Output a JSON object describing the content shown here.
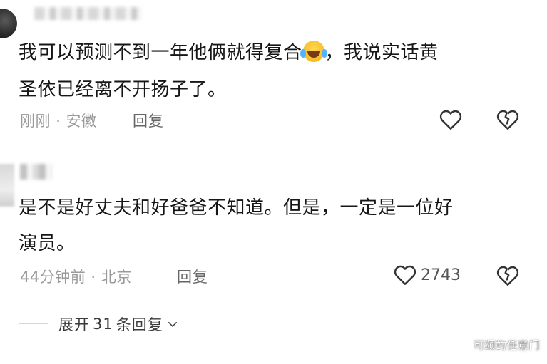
{
  "comments": [
    {
      "text_part1": "我可以预测不到一年他俩就得复合",
      "emoji": "rolling-on-floor-laughing",
      "text_part2": "，我说实话黄",
      "text_line2": "圣依已经离不开扬子了。",
      "time": "刚刚",
      "separator": "·",
      "location": "安徽",
      "reply_label": "回复",
      "like_count": ""
    },
    {
      "text_line1": "是不是好丈夫和好爸爸不知道。但是，一定是一位好",
      "text_line2": "演员。",
      "time": "44分钟前",
      "separator": "·",
      "location": "北京",
      "reply_label": "回复",
      "like_count": "2743"
    }
  ],
  "expand": {
    "label": "展开",
    "count": "31",
    "suffix": "条回复"
  },
  "watermark": "可颂的任意门",
  "icons": {
    "like": "heart-outline-icon",
    "dislike": "broken-heart-icon",
    "expand": "chevron-down-icon"
  },
  "colors": {
    "text": "#161616",
    "meta": "#9a9a9a",
    "icon": "#333333"
  }
}
